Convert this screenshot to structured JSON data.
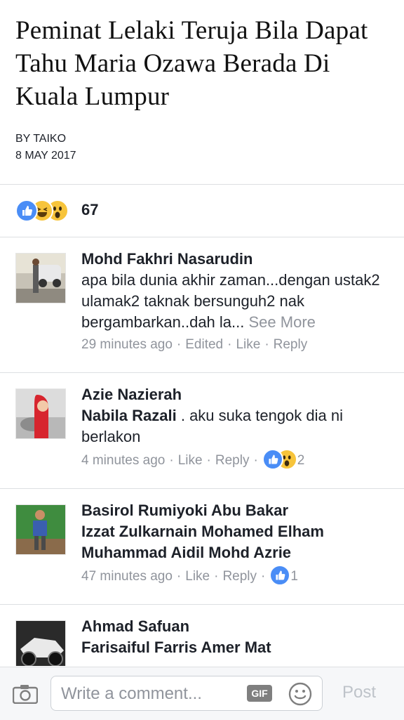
{
  "article": {
    "title": "Peminat Lelaki Teruja Bila Dapat Tahu Maria Ozawa Berada Di Kuala Lumpur",
    "author": "BY TAIKO",
    "date": "8 MAY 2017"
  },
  "reactions": {
    "icons": [
      "like-icon",
      "haha-icon",
      "wow-icon"
    ],
    "count": "67",
    "colors": {
      "like": "#4a8df6",
      "haha": "#f7c43b",
      "wow": "#f7c43b"
    }
  },
  "comments": [
    {
      "name": "Mohd Fakhri Nasarudin",
      "text": "apa bila dunia akhir zaman...dengan ustak2 ulamak2 taknak bersunguh2 nak bergambarkan..dah la...",
      "see_more": "See More",
      "time": "29 minutes ago",
      "edited": "Edited",
      "like": "Like",
      "reply": "Reply"
    },
    {
      "name": "Azie Nazierah",
      "tag": "Nabila Razali",
      "text": ". aku suka tengok dia ni berlakon",
      "time": "4 minutes ago",
      "like": "Like",
      "reply": "Reply",
      "reaction_count": "2"
    },
    {
      "name": "Basirol Rumiyoki Abu Bakar",
      "tags": [
        "Izzat Zulkarnain Mohamed Elham",
        "Muhammad Aidil Mohd Azrie"
      ],
      "time": "47 minutes ago",
      "like": "Like",
      "reply": "Reply",
      "reaction_count": "1"
    },
    {
      "name": "Ahmad Safuan",
      "tag": "Farisaiful Farris Amer Mat"
    }
  ],
  "composer": {
    "placeholder": "Write a comment...",
    "gif_label": "GIF",
    "post_label": "Post"
  },
  "separator": "·"
}
